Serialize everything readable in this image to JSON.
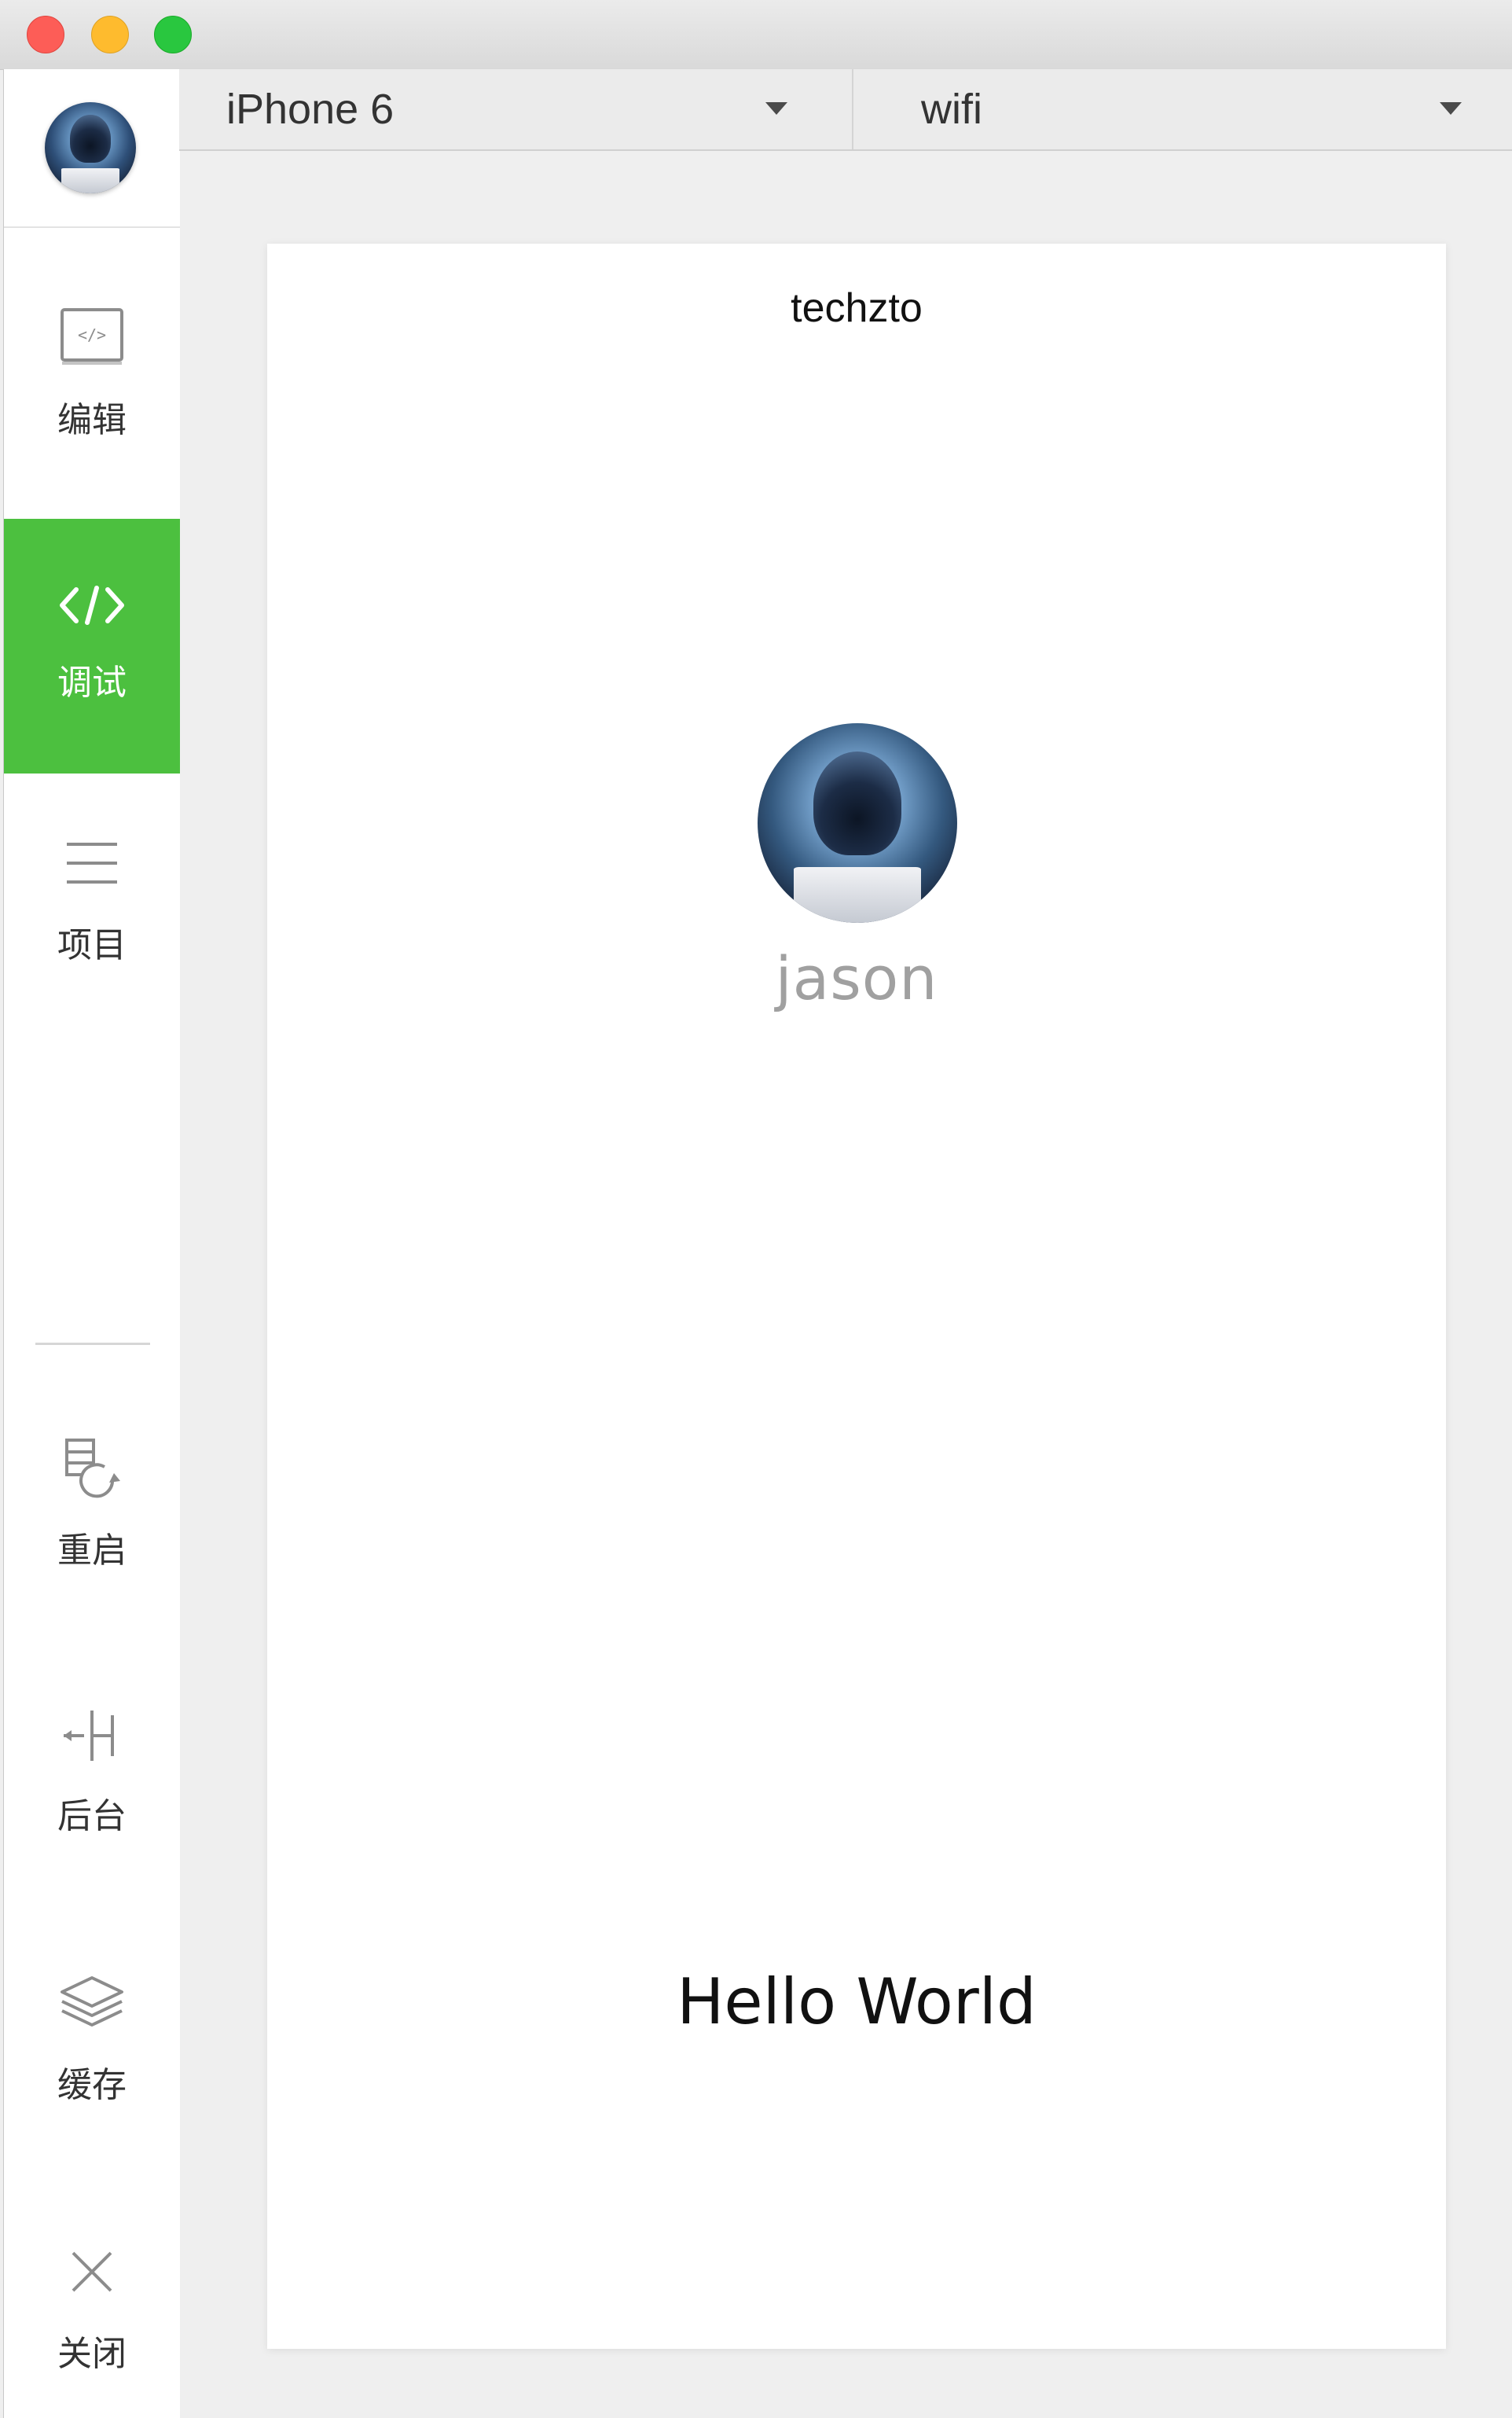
{
  "window": {
    "buttons": [
      "close",
      "minimize",
      "zoom"
    ]
  },
  "sidebar": {
    "items": [
      {
        "label": "编辑",
        "icon": "code-window-icon",
        "active": false
      },
      {
        "label": "调试",
        "icon": "code-brackets-icon",
        "active": true
      },
      {
        "label": "项目",
        "icon": "menu-lines-icon",
        "active": false
      },
      {
        "label": "重启",
        "icon": "restart-icon",
        "active": false
      },
      {
        "label": "后台",
        "icon": "background-icon",
        "active": false
      },
      {
        "label": "缓存",
        "icon": "layers-icon",
        "active": false
      },
      {
        "label": "关闭",
        "icon": "close-icon",
        "active": false
      }
    ],
    "active_color": "#4cc03f"
  },
  "toolbar": {
    "device": "iPhone 6",
    "network": "wifi"
  },
  "preview": {
    "nav_title": "techzto",
    "username": "jason",
    "message": "Hello World"
  }
}
